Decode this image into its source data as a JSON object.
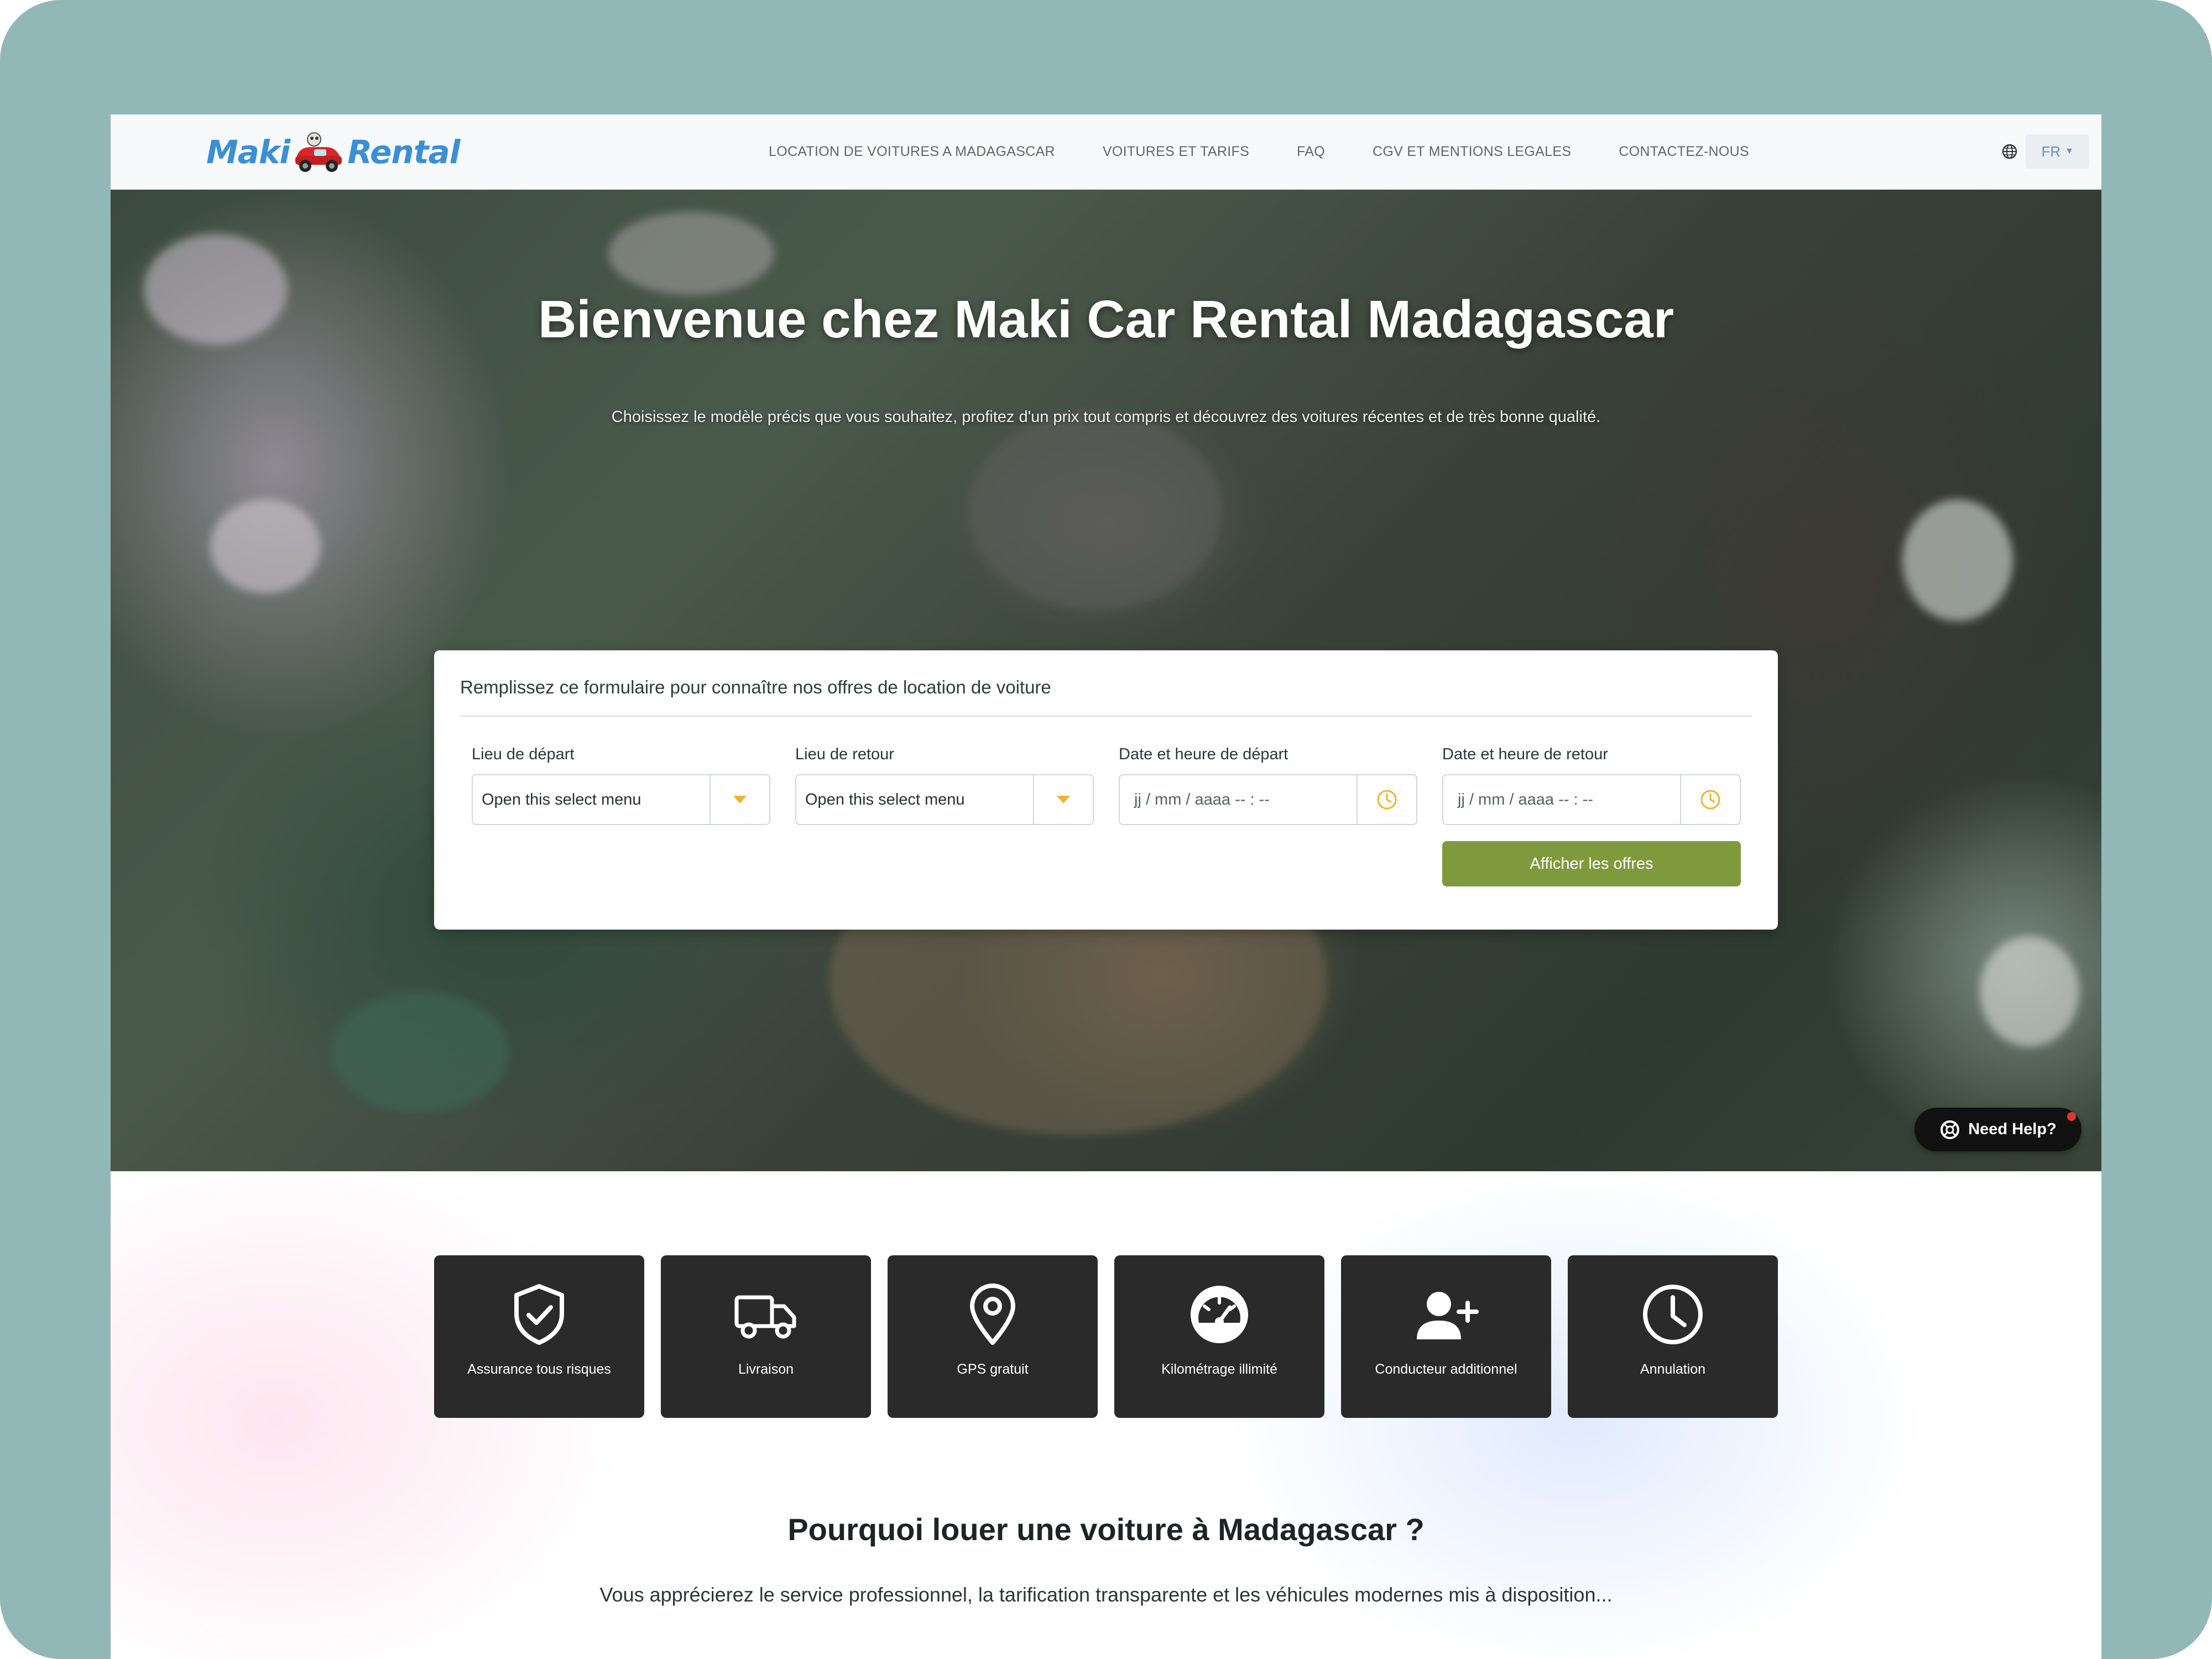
{
  "brand": {
    "logo_left": "Maki",
    "logo_right": "Rental",
    "logo_color": "#3a8fd6"
  },
  "nav": {
    "items": [
      {
        "label": "LOCATION DE VOITURES A MADAGASCAR"
      },
      {
        "label": "VOITURES ET TARIFS"
      },
      {
        "label": "FAQ"
      },
      {
        "label": "CGV ET MENTIONS LEGALES"
      },
      {
        "label": "CONTACTEZ-NOUS"
      }
    ],
    "language": "FR",
    "globe_icon": "globe-icon"
  },
  "hero": {
    "title": "Bienvenue chez Maki Car Rental Madagascar",
    "subtitle": "Choisissez le modèle précis que vous souhaitez, profitez d'un prix tout compris et découvrez des voitures récentes et de très bonne qualité."
  },
  "search_form": {
    "heading": "Remplissez ce formulaire pour connaître nos offres de location de voiture",
    "fields": [
      {
        "label": "Lieu de départ",
        "value": "Open this select menu",
        "icon": "caret-down-icon"
      },
      {
        "label": "Lieu de retour",
        "value": "Open this select menu",
        "icon": "caret-down-icon"
      },
      {
        "label": "Date et heure de départ",
        "value": "jj / mm / aaaa   -- : --",
        "icon": "clock-icon"
      },
      {
        "label": "Date et heure de retour",
        "value": "jj / mm / aaaa   -- : --",
        "icon": "clock-icon"
      }
    ],
    "submit_label": "Afficher les offres",
    "accent_color": "#7f9a3c",
    "icon_color": "#f0b429"
  },
  "help": {
    "label": "Need Help?",
    "icon": "lifebuoy-icon"
  },
  "features": [
    {
      "label": "Assurance tous risques",
      "icon": "shield-check-icon"
    },
    {
      "label": "Livraison",
      "icon": "truck-icon"
    },
    {
      "label": "GPS gratuit",
      "icon": "map-pin-icon"
    },
    {
      "label": "Kilométrage illimité",
      "icon": "speedometer-icon"
    },
    {
      "label": "Conducteur additionnel",
      "icon": "user-plus-icon"
    },
    {
      "label": "Annulation",
      "icon": "clock-icon"
    }
  ],
  "why": {
    "title": "Pourquoi louer une voiture à Madagascar ?",
    "text": "Vous apprécierez le service professionnel, la tarification transparente et les véhicules modernes mis à disposition..."
  }
}
